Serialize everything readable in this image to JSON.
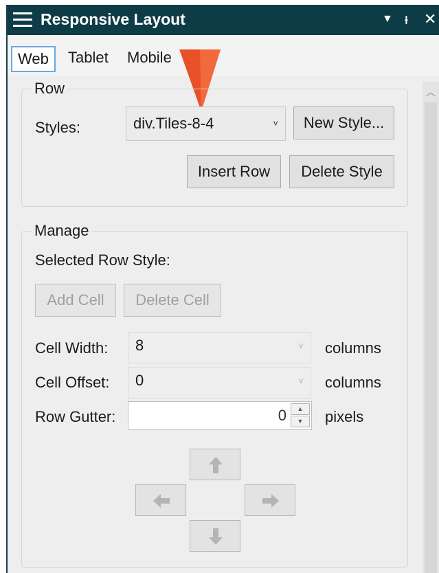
{
  "window": {
    "title": "Responsive Layout"
  },
  "titlebar_icons": {
    "dropdown": "▼",
    "pin": "ᵼ",
    "close": "✕"
  },
  "tabs": [
    {
      "label": "Web",
      "active": true
    },
    {
      "label": "Tablet",
      "active": false
    },
    {
      "label": "Mobile",
      "active": false
    }
  ],
  "row_group": {
    "legend": "Row",
    "styles_label": "Styles:",
    "styles_value": "div.Tiles-8-4",
    "new_style": "New Style...",
    "insert_row": "Insert Row",
    "delete_style": "Delete Style"
  },
  "manage_group": {
    "legend": "Manage",
    "selected_row_style": "Selected Row Style:",
    "add_cell": "Add Cell",
    "delete_cell": "Delete Cell",
    "cell_width_label": "Cell Width:",
    "cell_width_value": "8",
    "cell_width_unit": "columns",
    "cell_offset_label": "Cell Offset:",
    "cell_offset_value": "0",
    "cell_offset_unit": "columns",
    "row_gutter_label": "Row Gutter:",
    "row_gutter_value": "0",
    "row_gutter_unit": "pixels"
  },
  "colors": {
    "titlebar": "#0d3c47",
    "pointer": "#e8502a",
    "tab_border": "#6aa9dc"
  }
}
